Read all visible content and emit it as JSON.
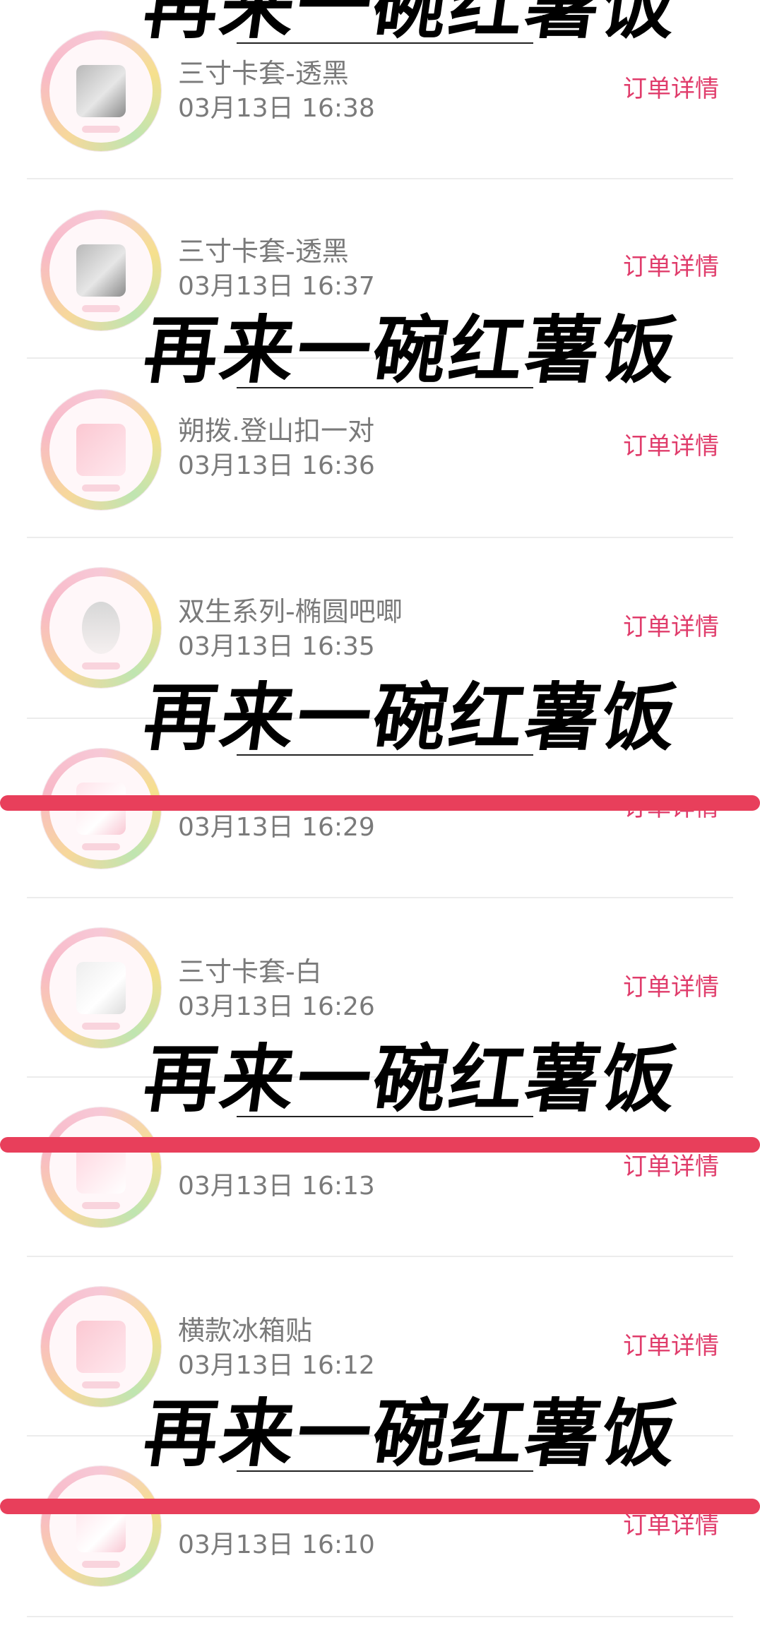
{
  "colors": {
    "detail_link": "#e03c6b",
    "text": "#7a7a7a",
    "divider": "#ececec",
    "strike": "#e83f5b",
    "watermark": "#000000"
  },
  "watermark_text": "再来一碗红薯饭",
  "orders": [
    {
      "title": "三寸卡套-透黑",
      "time": "03月13日 16:38",
      "detail": "订单详情",
      "thumb_icon": "card-sleeve-black-thumbnail"
    },
    {
      "title": "三寸卡套-透黑",
      "time": "03月13日 16:37",
      "detail": "订单详情",
      "thumb_icon": "card-sleeve-black-thumbnail"
    },
    {
      "title": "朔拨.登山扣一对",
      "time": "03月13日 16:36",
      "detail": "订单详情",
      "thumb_icon": "carabiner-thumbnail"
    },
    {
      "title": "双生系列-椭圆吧唧",
      "time": "03月13日 16:35",
      "detail": "订单详情",
      "thumb_icon": "oval-badge-thumbnail"
    },
    {
      "title": "",
      "time": "03月13日 16:29",
      "detail": "订单详情",
      "thumb_icon": "card-sleeve-red-thumbnail"
    },
    {
      "title": "三寸卡套-白",
      "time": "03月13日 16:26",
      "detail": "订单详情",
      "thumb_icon": "card-sleeve-white-thumbnail"
    },
    {
      "title": "",
      "time": "03月13日 16:13",
      "detail": "订单详情",
      "thumb_icon": "paper-bag-thumbnail"
    },
    {
      "title": "横款冰箱贴",
      "time": "03月13日 16:12",
      "detail": "订单详情",
      "thumb_icon": "fridge-magnet-thumbnail"
    },
    {
      "title": "",
      "time": "03月13日 16:10",
      "detail": "订单详情",
      "thumb_icon": "card-sleeve-pink-thumbnail"
    }
  ]
}
